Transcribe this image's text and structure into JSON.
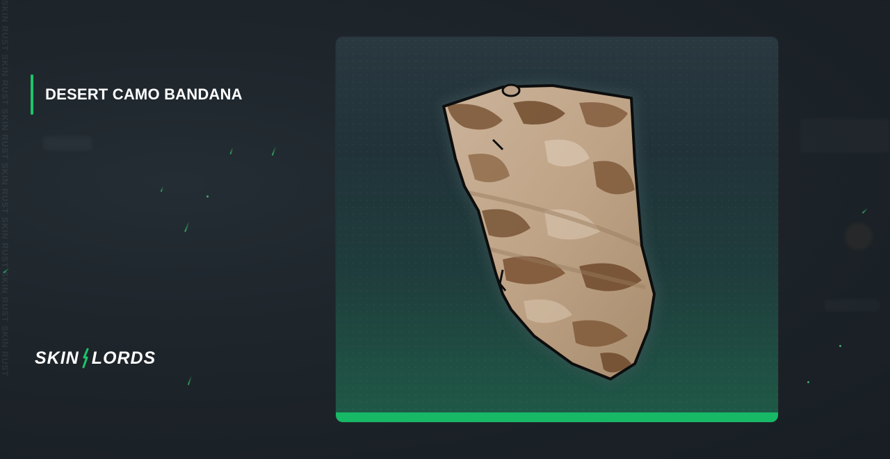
{
  "item": {
    "name": "DESERT CAMO BANDANA",
    "image_icon": "camo-bandana-icon"
  },
  "brand": {
    "logo_left": "SKIN",
    "logo_right": "LORDS"
  },
  "watermark": {
    "text": "SKIN RUST SKIN RUST SKIN RUST SKIN RUST SKIN RUST SKIN RUST SKIN RUST"
  },
  "colors": {
    "accent": "#1ec469",
    "rarity": "#17b866",
    "background": "#1c2329"
  }
}
